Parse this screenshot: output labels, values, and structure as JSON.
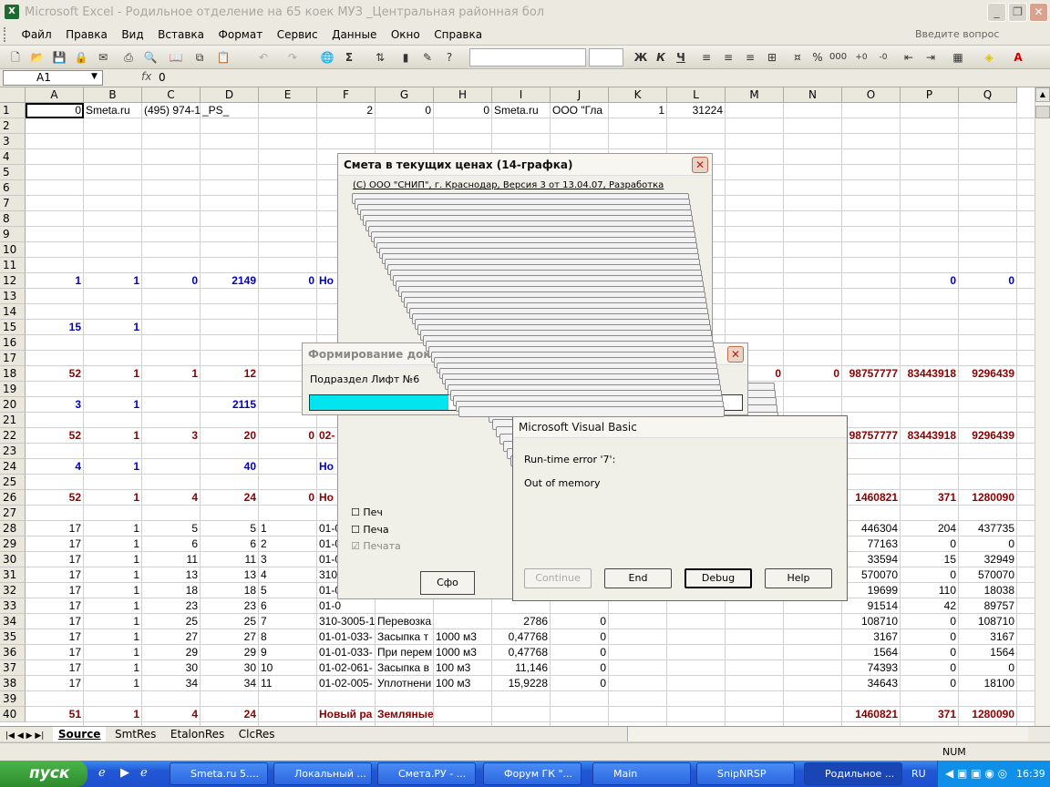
{
  "window": {
    "title": "Microsoft Excel - Родильное отделение на 65 коек МУЗ _Центральная районная бол",
    "app_icon": "X"
  },
  "menu": [
    "Файл",
    "Правка",
    "Вид",
    "Вставка",
    "Формат",
    "Сервис",
    "Данные",
    "Окно",
    "Справка"
  ],
  "ask_placeholder": "Введите вопрос",
  "formula": {
    "cell": "A1",
    "fx": "fx",
    "value": "0"
  },
  "columns": [
    "A",
    "B",
    "C",
    "D",
    "E",
    "F",
    "G",
    "H",
    "I",
    "J",
    "K",
    "L",
    "M",
    "N",
    "O",
    "P",
    "Q"
  ],
  "rows": [
    {
      "n": "1",
      "cells": [
        [
          "A",
          "0",
          ""
        ],
        [
          "B",
          "Smeta.ru",
          "l"
        ],
        [
          "C",
          "(495) 974-1",
          "l"
        ],
        [
          "D",
          "_PS_",
          "l"
        ],
        [
          "F",
          "2",
          ""
        ],
        [
          "G",
          "0",
          ""
        ],
        [
          "H",
          "0",
          ""
        ],
        [
          "I",
          "Smeta.ru",
          "l"
        ],
        [
          "J",
          "ООО \"Гла",
          "l"
        ],
        [
          "K",
          "1",
          ""
        ],
        [
          "L",
          "31224",
          ""
        ]
      ]
    },
    {
      "n": "2",
      "cells": []
    },
    {
      "n": "3",
      "cells": []
    },
    {
      "n": "4",
      "cells": []
    },
    {
      "n": "5",
      "cells": []
    },
    {
      "n": "6",
      "cells": []
    },
    {
      "n": "7",
      "cells": []
    },
    {
      "n": "8",
      "cells": []
    },
    {
      "n": "9",
      "cells": []
    },
    {
      "n": "10",
      "cells": []
    },
    {
      "n": "11",
      "cells": []
    },
    {
      "n": "12",
      "style": "blue",
      "cells": [
        [
          "A",
          "1",
          ""
        ],
        [
          "B",
          "1",
          ""
        ],
        [
          "C",
          "0",
          ""
        ],
        [
          "D",
          "2149",
          ""
        ],
        [
          "E",
          "0",
          ""
        ],
        [
          "F",
          "Но",
          "l"
        ],
        [
          "P",
          "0",
          ""
        ],
        [
          "Q",
          "0",
          ""
        ]
      ]
    },
    {
      "n": "13",
      "cells": []
    },
    {
      "n": "14",
      "cells": []
    },
    {
      "n": "15",
      "style": "blue",
      "cells": [
        [
          "A",
          "15",
          ""
        ],
        [
          "B",
          "1",
          ""
        ]
      ]
    },
    {
      "n": "16",
      "cells": []
    },
    {
      "n": "17",
      "cells": []
    },
    {
      "n": "18",
      "style": "red",
      "cells": [
        [
          "A",
          "52",
          ""
        ],
        [
          "B",
          "1",
          ""
        ],
        [
          "C",
          "1",
          ""
        ],
        [
          "D",
          "12",
          ""
        ],
        [
          "M",
          "0",
          ""
        ],
        [
          "N",
          "0",
          ""
        ],
        [
          "O",
          "98757777",
          ""
        ],
        [
          "P",
          "83443918",
          ""
        ],
        [
          "Q",
          "9296439",
          ""
        ]
      ]
    },
    {
      "n": "19",
      "cells": []
    },
    {
      "n": "20",
      "style": "blue",
      "cells": [
        [
          "A",
          "3",
          ""
        ],
        [
          "B",
          "1",
          ""
        ],
        [
          "D",
          "2115",
          ""
        ]
      ]
    },
    {
      "n": "21",
      "cells": []
    },
    {
      "n": "22",
      "style": "red",
      "cells": [
        [
          "A",
          "52",
          ""
        ],
        [
          "B",
          "1",
          ""
        ],
        [
          "C",
          "3",
          ""
        ],
        [
          "D",
          "20",
          ""
        ],
        [
          "E",
          "0",
          ""
        ],
        [
          "F",
          "02-",
          "l"
        ],
        [
          "O",
          "98757777",
          ""
        ],
        [
          "P",
          "83443918",
          ""
        ],
        [
          "Q",
          "9296439",
          ""
        ]
      ]
    },
    {
      "n": "23",
      "cells": []
    },
    {
      "n": "24",
      "style": "blue",
      "cells": [
        [
          "A",
          "4",
          ""
        ],
        [
          "B",
          "1",
          ""
        ],
        [
          "D",
          "40",
          ""
        ],
        [
          "F",
          "Но",
          "l"
        ]
      ]
    },
    {
      "n": "25",
      "cells": []
    },
    {
      "n": "26",
      "style": "red",
      "cells": [
        [
          "A",
          "52",
          ""
        ],
        [
          "B",
          "1",
          ""
        ],
        [
          "C",
          "4",
          ""
        ],
        [
          "D",
          "24",
          ""
        ],
        [
          "E",
          "0",
          ""
        ],
        [
          "F",
          "Но",
          "l"
        ],
        [
          "O",
          "1460821",
          ""
        ],
        [
          "P",
          "371",
          ""
        ],
        [
          "Q",
          "1280090",
          ""
        ]
      ]
    },
    {
      "n": "27",
      "cells": []
    },
    {
      "n": "28",
      "cells": [
        [
          "A",
          "17",
          ""
        ],
        [
          "B",
          "1",
          ""
        ],
        [
          "C",
          "5",
          ""
        ],
        [
          "D",
          "5",
          ""
        ],
        [
          "E",
          "1",
          "l"
        ],
        [
          "F",
          "01-0",
          "l"
        ],
        [
          "O",
          "446304",
          ""
        ],
        [
          "P",
          "204",
          ""
        ],
        [
          "Q",
          "437735",
          ""
        ]
      ]
    },
    {
      "n": "29",
      "cells": [
        [
          "A",
          "17",
          ""
        ],
        [
          "B",
          "1",
          ""
        ],
        [
          "C",
          "6",
          ""
        ],
        [
          "D",
          "6",
          ""
        ],
        [
          "E",
          "2",
          "l"
        ],
        [
          "F",
          "01-0",
          "l"
        ],
        [
          "O",
          "77163",
          ""
        ],
        [
          "P",
          "0",
          ""
        ],
        [
          "Q",
          "0",
          ""
        ]
      ]
    },
    {
      "n": "30",
      "cells": [
        [
          "A",
          "17",
          ""
        ],
        [
          "B",
          "1",
          ""
        ],
        [
          "C",
          "11",
          ""
        ],
        [
          "D",
          "11",
          ""
        ],
        [
          "E",
          "3",
          "l"
        ],
        [
          "F",
          "01-0",
          "l"
        ],
        [
          "O",
          "33594",
          ""
        ],
        [
          "P",
          "15",
          ""
        ],
        [
          "Q",
          "32949",
          ""
        ]
      ]
    },
    {
      "n": "31",
      "cells": [
        [
          "A",
          "17",
          ""
        ],
        [
          "B",
          "1",
          ""
        ],
        [
          "C",
          "13",
          ""
        ],
        [
          "D",
          "13",
          ""
        ],
        [
          "E",
          "4",
          "l"
        ],
        [
          "F",
          "310",
          "l"
        ],
        [
          "O",
          "570070",
          ""
        ],
        [
          "P",
          "0",
          ""
        ],
        [
          "Q",
          "570070",
          ""
        ]
      ]
    },
    {
      "n": "32",
      "cells": [
        [
          "A",
          "17",
          ""
        ],
        [
          "B",
          "1",
          ""
        ],
        [
          "C",
          "18",
          ""
        ],
        [
          "D",
          "18",
          ""
        ],
        [
          "E",
          "5",
          "l"
        ],
        [
          "F",
          "01-0",
          "l"
        ],
        [
          "O",
          "19699",
          ""
        ],
        [
          "P",
          "110",
          ""
        ],
        [
          "Q",
          "18038",
          ""
        ]
      ]
    },
    {
      "n": "33",
      "cells": [
        [
          "A",
          "17",
          ""
        ],
        [
          "B",
          "1",
          ""
        ],
        [
          "C",
          "23",
          ""
        ],
        [
          "D",
          "23",
          ""
        ],
        [
          "E",
          "6",
          "l"
        ],
        [
          "F",
          "01-0",
          "l"
        ],
        [
          "O",
          "91514",
          ""
        ],
        [
          "P",
          "42",
          ""
        ],
        [
          "Q",
          "89757",
          ""
        ]
      ]
    },
    {
      "n": "34",
      "cells": [
        [
          "A",
          "17",
          ""
        ],
        [
          "B",
          "1",
          ""
        ],
        [
          "C",
          "25",
          ""
        ],
        [
          "D",
          "25",
          ""
        ],
        [
          "E",
          "7",
          "l"
        ],
        [
          "F",
          "310-3005-1",
          "l"
        ],
        [
          "G",
          "Перевозка т",
          "l"
        ],
        [
          "I",
          "2786",
          ""
        ],
        [
          "J",
          "0",
          ""
        ],
        [
          "O",
          "108710",
          ""
        ],
        [
          "P",
          "0",
          ""
        ],
        [
          "Q",
          "108710",
          ""
        ]
      ]
    },
    {
      "n": "35",
      "cells": [
        [
          "A",
          "17",
          ""
        ],
        [
          "B",
          "1",
          ""
        ],
        [
          "C",
          "27",
          ""
        ],
        [
          "D",
          "27",
          ""
        ],
        [
          "E",
          "8",
          "l"
        ],
        [
          "F",
          "01-01-033-",
          "l"
        ],
        [
          "G",
          "Засыпка т",
          "l"
        ],
        [
          "H",
          "1000 м3",
          "l"
        ],
        [
          "I",
          "0,47768",
          ""
        ],
        [
          "J",
          "0",
          ""
        ],
        [
          "O",
          "3167",
          ""
        ],
        [
          "P",
          "0",
          ""
        ],
        [
          "Q",
          "3167",
          ""
        ]
      ]
    },
    {
      "n": "36",
      "cells": [
        [
          "A",
          "17",
          ""
        ],
        [
          "B",
          "1",
          ""
        ],
        [
          "C",
          "29",
          ""
        ],
        [
          "D",
          "29",
          ""
        ],
        [
          "E",
          "9",
          "l"
        ],
        [
          "F",
          "01-01-033-",
          "l"
        ],
        [
          "G",
          "При перем",
          "l"
        ],
        [
          "H",
          "1000 м3",
          "l"
        ],
        [
          "I",
          "0,47768",
          ""
        ],
        [
          "J",
          "0",
          ""
        ],
        [
          "O",
          "1564",
          ""
        ],
        [
          "P",
          "0",
          ""
        ],
        [
          "Q",
          "1564",
          ""
        ]
      ]
    },
    {
      "n": "37",
      "cells": [
        [
          "A",
          "17",
          ""
        ],
        [
          "B",
          "1",
          ""
        ],
        [
          "C",
          "30",
          ""
        ],
        [
          "D",
          "30",
          ""
        ],
        [
          "E",
          "10",
          "l"
        ],
        [
          "F",
          "01-02-061-",
          "l"
        ],
        [
          "G",
          "Засыпка в",
          "l"
        ],
        [
          "H",
          "100 м3",
          "l"
        ],
        [
          "I",
          "11,146",
          ""
        ],
        [
          "J",
          "0",
          ""
        ],
        [
          "O",
          "74393",
          ""
        ],
        [
          "P",
          "0",
          ""
        ],
        [
          "Q",
          "0",
          ""
        ]
      ]
    },
    {
      "n": "38",
      "cells": [
        [
          "A",
          "17",
          ""
        ],
        [
          "B",
          "1",
          ""
        ],
        [
          "C",
          "34",
          ""
        ],
        [
          "D",
          "34",
          ""
        ],
        [
          "E",
          "11",
          "l"
        ],
        [
          "F",
          "01-02-005-",
          "l"
        ],
        [
          "G",
          "Уплотнени",
          "l"
        ],
        [
          "H",
          "100 м3",
          "l"
        ],
        [
          "I",
          "15,9228",
          ""
        ],
        [
          "J",
          "0",
          ""
        ],
        [
          "O",
          "34643",
          ""
        ],
        [
          "P",
          "0",
          ""
        ],
        [
          "Q",
          "18100",
          ""
        ]
      ]
    },
    {
      "n": "39",
      "cells": []
    },
    {
      "n": "40",
      "style": "red",
      "cells": [
        [
          "A",
          "51",
          ""
        ],
        [
          "B",
          "1",
          ""
        ],
        [
          "C",
          "4",
          ""
        ],
        [
          "D",
          "24",
          ""
        ],
        [
          "F",
          "Новый ра",
          "l"
        ],
        [
          "G",
          "Земляные работы",
          "l"
        ],
        [
          "O",
          "1460821",
          ""
        ],
        [
          "P",
          "371",
          ""
        ],
        [
          "Q",
          "1280090",
          ""
        ]
      ]
    }
  ],
  "sheet_tabs": [
    "Source",
    "SmtRes",
    "EtalonRes",
    "ClcRes"
  ],
  "status": {
    "num": "NUM"
  },
  "smeta_dialog": {
    "title": "Смета в текущих ценах (14-графка)",
    "copyright": "(С) ООО \"СНИП\", г. Краснодар, Версия 3 от 13.04.07, Разработка",
    "check1": "Печ",
    "check2": "Печа",
    "check3": "Печата",
    "button": "Сфо"
  },
  "progress_dialog": {
    "title": "Формирование документа",
    "subtitle": "Подраздел Лифт №6",
    "percent": 32,
    "percent_label": "32%"
  },
  "vb_dialog": {
    "title": "Microsoft Visual Basic",
    "line1": "Run-time error '7':",
    "line2": "Out of memory",
    "buttons": {
      "continue": "Continue",
      "end": "End",
      "debug": "Debug",
      "help": "Help"
    }
  },
  "taskbar": {
    "start": "пуск",
    "tasks": [
      "Smeta.ru  5....",
      "Локальный ...",
      "Смета.РУ - ...",
      "Форум ГК \"...",
      "Main",
      "SnipNRSP",
      "Родильное ..."
    ],
    "lang": "RU",
    "clock": "16:39"
  }
}
